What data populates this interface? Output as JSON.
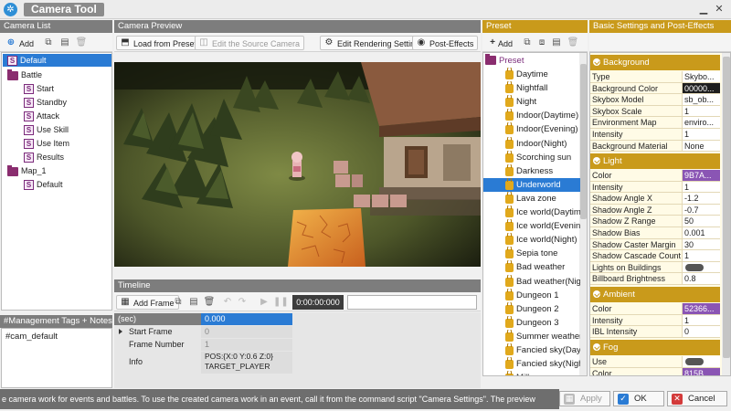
{
  "app": {
    "title": "Camera Tool",
    "icon": "app-gear-icon"
  },
  "camera_list": {
    "header": "Camera List",
    "add_label": "Add",
    "items": [
      {
        "label": "Default",
        "type": "scene",
        "level": 0
      },
      {
        "label": "Battle",
        "type": "folder",
        "level": 0
      },
      {
        "label": "Start",
        "type": "scene",
        "level": 1
      },
      {
        "label": "Standby",
        "type": "scene",
        "level": 1
      },
      {
        "label": "Attack",
        "type": "scene",
        "level": 1
      },
      {
        "label": "Use Skill",
        "type": "scene",
        "level": 1
      },
      {
        "label": "Use Item",
        "type": "scene",
        "level": 1
      },
      {
        "label": "Results",
        "type": "scene",
        "level": 1
      },
      {
        "label": "Map_1",
        "type": "folder",
        "level": 0
      },
      {
        "label": "Default",
        "type": "scene",
        "level": 1
      }
    ]
  },
  "tags": {
    "header": "#Management Tags + Notes",
    "value": "#cam_default"
  },
  "preview": {
    "header": "Camera Preview",
    "load_label": "Load from Presets",
    "edit_source_label": "Edit the Source Camera",
    "edit_rendering_label": "Edit Rendering Settings",
    "post_effects_label": "Post-Effects"
  },
  "timeline": {
    "header": "Timeline",
    "add_frame_label": "Add Frame",
    "time_display": "0:00:00:000",
    "rows": [
      {
        "label": "(sec)",
        "value": "0.000"
      },
      {
        "label": "Start Frame",
        "value": "0"
      },
      {
        "label": "Frame Number",
        "value": "1"
      },
      {
        "label": "Info",
        "value": "POS:{X:0 Y:0.6 Z:0}",
        "value2": "TARGET_PLAYER"
      }
    ]
  },
  "preset": {
    "header": "Preset",
    "add_label": "Add",
    "root_label": "Preset",
    "items": [
      "Daytime",
      "Nightfall",
      "Night",
      "Indoor(Daytime)",
      "Indoor(Evening)",
      "Indoor(Night)",
      "Scorching sun",
      "Darkness",
      "Underworld",
      "Lava zone",
      "Ice world(Daytime)",
      "Ice world(Evening)",
      "Ice world(Night)",
      "Sepia tone",
      "Bad weather",
      "Bad weather(Night)",
      "Dungeon 1",
      "Dungeon 2",
      "Dungeon 3",
      "Summer weather",
      "Fancied sky(Daytime)",
      "Fancied sky(Night)",
      "Milky way"
    ],
    "selected_index": 8
  },
  "settings": {
    "header": "Basic Settings and Post-Effects",
    "background": {
      "title": "Background",
      "rows": [
        {
          "label": "Type",
          "value": "Skybo..."
        },
        {
          "label": "Background Color",
          "value": "00000..."
        },
        {
          "label": "Skybox Model",
          "value": "sb_ob..."
        },
        {
          "label": "Skybox Scale",
          "value": "1"
        },
        {
          "label": "Environment Map",
          "value": "enviro..."
        },
        {
          "label": "Intensity",
          "value": "1"
        },
        {
          "label": "Background Material",
          "value": "None"
        }
      ]
    },
    "light": {
      "title": "Light",
      "rows": [
        {
          "label": "Color",
          "value": "9B7A..."
        },
        {
          "label": "Intensity",
          "value": "1"
        },
        {
          "label": "Shadow Angle X",
          "value": "-1.2"
        },
        {
          "label": "Shadow Angle Z",
          "value": "-0.7"
        },
        {
          "label": "Shadow Z Range",
          "value": "50"
        },
        {
          "label": "Shadow Bias",
          "value": "0.001"
        },
        {
          "label": "Shadow Caster Margin",
          "value": "30"
        },
        {
          "label": "Shadow Cascade Count",
          "value": "1"
        },
        {
          "label": "Lights on Buildings",
          "value": ""
        },
        {
          "label": "Billboard Brightness",
          "value": "0.8"
        }
      ]
    },
    "ambient": {
      "title": "Ambient",
      "rows": [
        {
          "label": "Color",
          "value": "52366..."
        },
        {
          "label": "Intensity",
          "value": "1"
        },
        {
          "label": "IBL Intensity",
          "value": "0"
        }
      ]
    },
    "fog": {
      "title": "Fog",
      "rows": [
        {
          "label": "Use",
          "value": ""
        },
        {
          "label": "Color",
          "value": "815B..."
        }
      ]
    }
  },
  "status_bar": {
    "text": "e camera work for events and battles. To use the created camera work in an event, call it from the command script \"Camera Settings\". The preview"
  },
  "buttons": {
    "apply": "Apply",
    "ok": "OK",
    "cancel": "Cancel"
  }
}
